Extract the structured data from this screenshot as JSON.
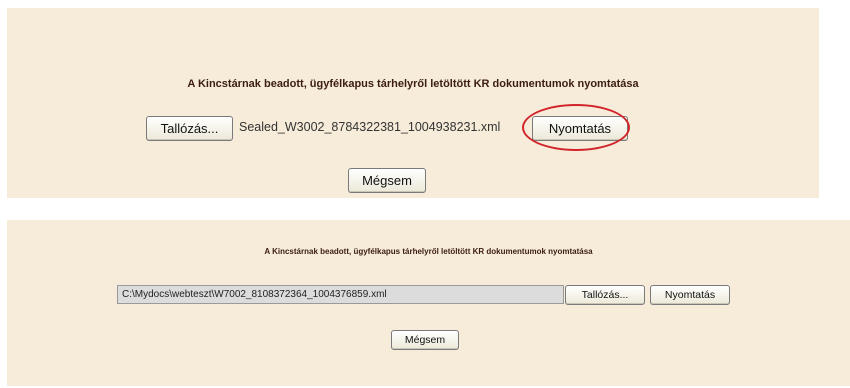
{
  "dialog_top": {
    "title": "A Kincstárnak beadott, ügyfélkapus tárhelyről letöltött KR dokumentumok nyomtatása",
    "browse_label": "Tallózás...",
    "filename": "Sealed_W3002_8784322381_1004938231.xml",
    "print_label": "Nyomtatás",
    "cancel_label": "Mégsem",
    "highlight_color": "#d2232a",
    "background_color": "#f6ecd9"
  },
  "dialog_bottom": {
    "title": "A Kincstárnak beadott, ügyfélkapus tárhelyről letöltött KR dokumentumok nyomtatása",
    "file_path": "C:\\Mydocs\\webteszt\\W7002_8108372364_1004376859.xml",
    "browse_label": "Tallózás...",
    "print_label": "Nyomtatás",
    "cancel_label": "Mégsem",
    "background_color": "#f6ecd9"
  }
}
